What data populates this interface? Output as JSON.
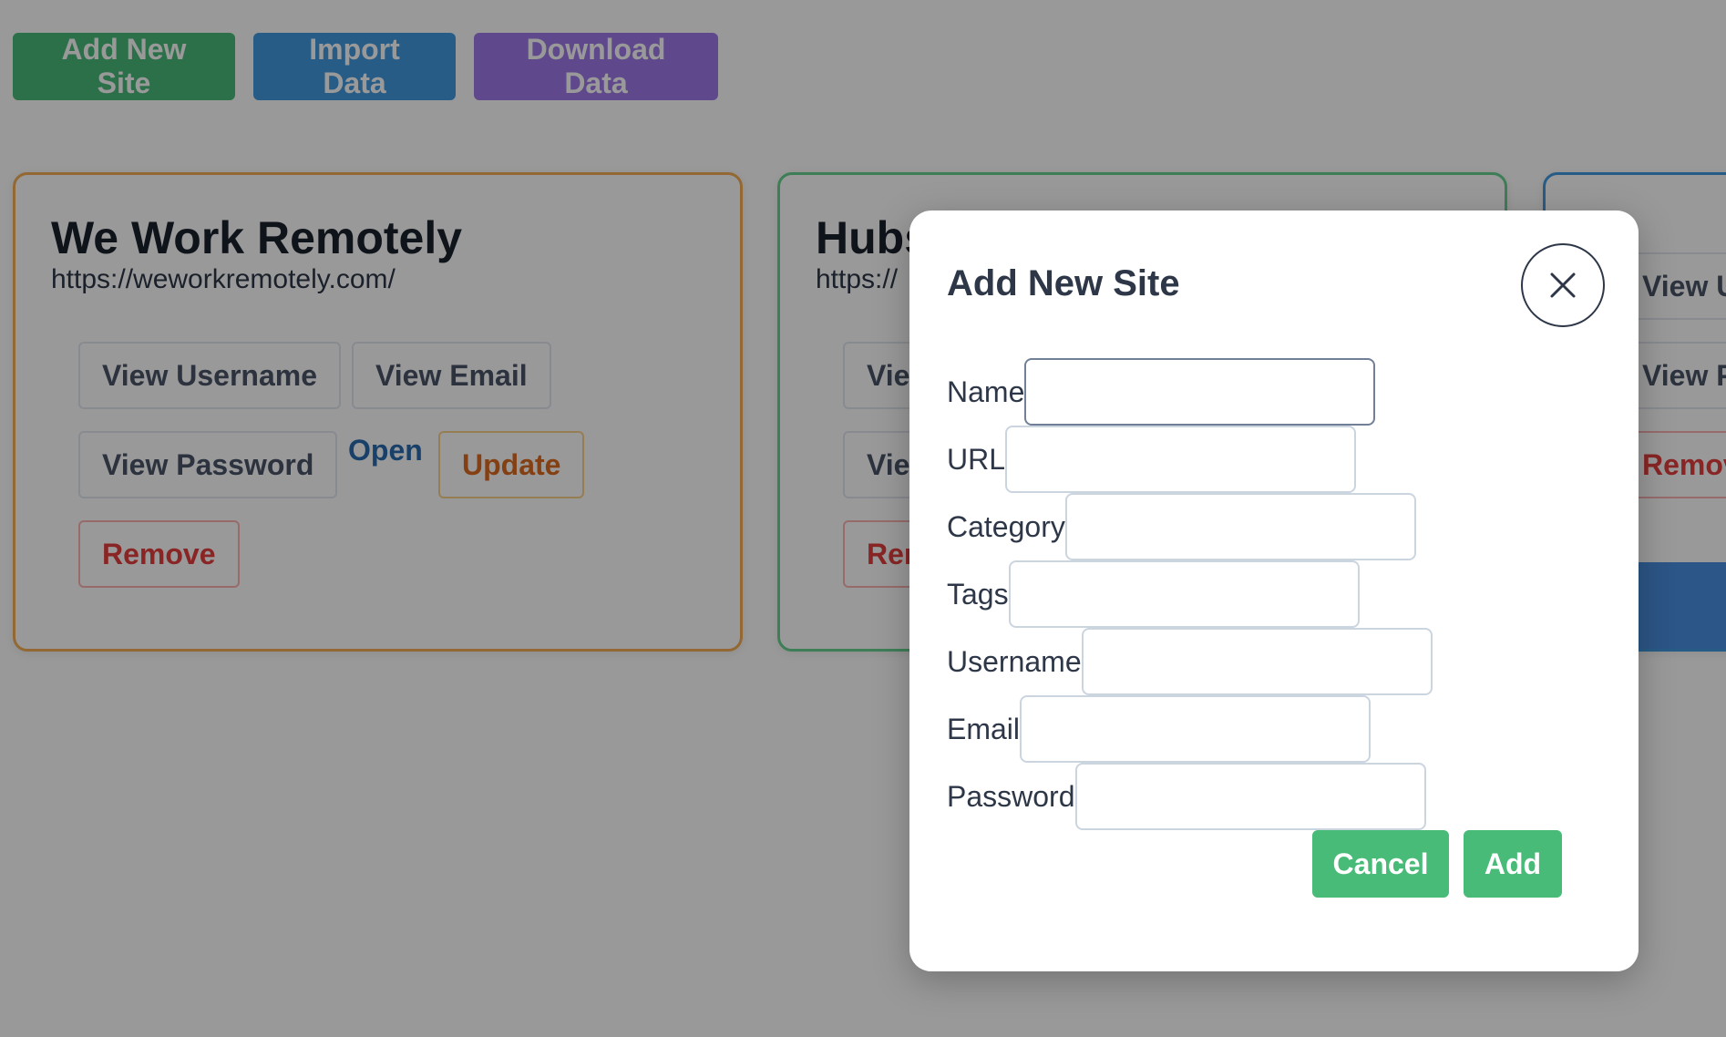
{
  "toolbar": {
    "add_new_site": "Add New Site",
    "import_data": "Import Data",
    "download_data": "Download Data"
  },
  "cards": [
    {
      "title": "We Work Remotely",
      "url": "https://weworkremotely.com/",
      "accent": "#f6ad55",
      "view_username": "View Username",
      "view_email": "View Email",
      "view_password": "View Password",
      "open": "Open",
      "update": "Update",
      "remove": "Remove"
    },
    {
      "title_partial": "Hubs",
      "url_partial": "https://",
      "accent": "#68d391",
      "view_1": "Vie",
      "view_2": "Vie",
      "remove": "Rer"
    },
    {
      "accent": "#4299e1",
      "view_username": "View Us",
      "view_password": "View Pa",
      "remove": "Remove"
    }
  ],
  "modal": {
    "title": "Add New Site",
    "close_icon": "close-icon",
    "fields": {
      "name": "Name",
      "url": "URL",
      "category": "Category",
      "tags": "Tags",
      "username": "Username",
      "email": "Email",
      "password": "Password"
    },
    "cancel": "Cancel",
    "add": "Add"
  },
  "colors": {
    "green": "#48bb78",
    "blue": "#4299e1",
    "purple": "#9f7aea"
  }
}
